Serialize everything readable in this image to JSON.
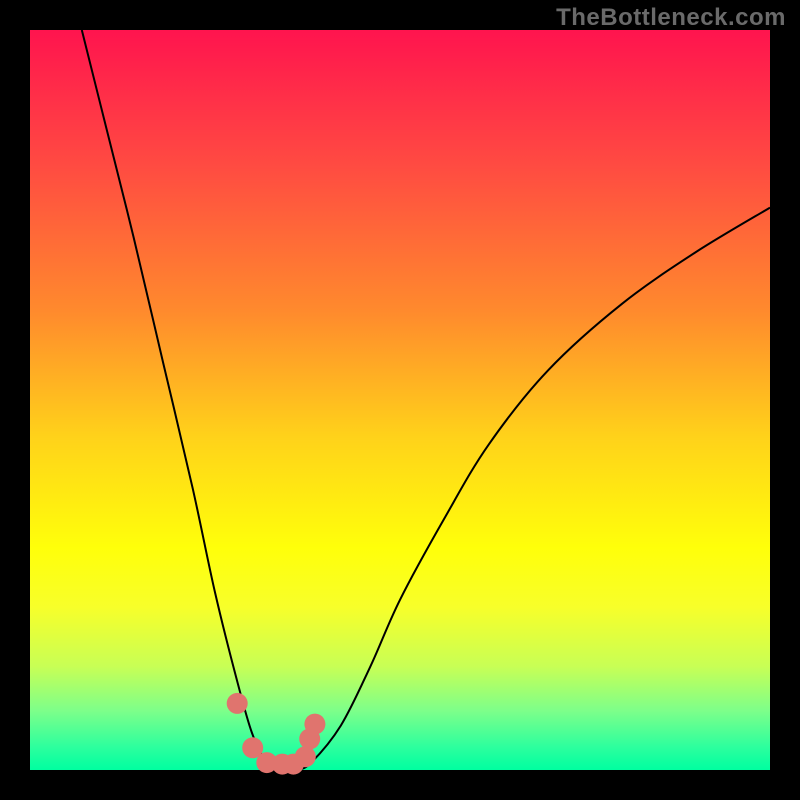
{
  "watermark": "TheBottleneck.com",
  "chart_data": {
    "type": "line",
    "title": "",
    "xlabel": "",
    "ylabel": "",
    "xlim": [
      0,
      100
    ],
    "ylim": [
      0,
      100
    ],
    "series": [
      {
        "name": "bottleneck-curve",
        "x": [
          7,
          10,
          14,
          18,
          22,
          25,
          28,
          30,
          32,
          34,
          36,
          38,
          42,
          46,
          50,
          56,
          62,
          70,
          80,
          90,
          100
        ],
        "y": [
          100,
          88,
          72,
          55,
          38,
          24,
          12,
          5,
          1,
          0,
          0,
          1,
          6,
          14,
          23,
          34,
          44,
          54,
          63,
          70,
          76
        ]
      }
    ],
    "markers": {
      "name": "highlight-dots",
      "x": [
        28.0,
        30.1,
        32.0,
        34.1,
        35.6,
        37.2,
        37.8,
        38.5
      ],
      "y": [
        9.0,
        3.0,
        1.0,
        0.8,
        0.8,
        1.8,
        4.2,
        6.2
      ]
    },
    "gradient": {
      "top_color": "#ff144e",
      "bottom_color": "#00ffa0"
    },
    "marker_color": "#e0746e"
  }
}
